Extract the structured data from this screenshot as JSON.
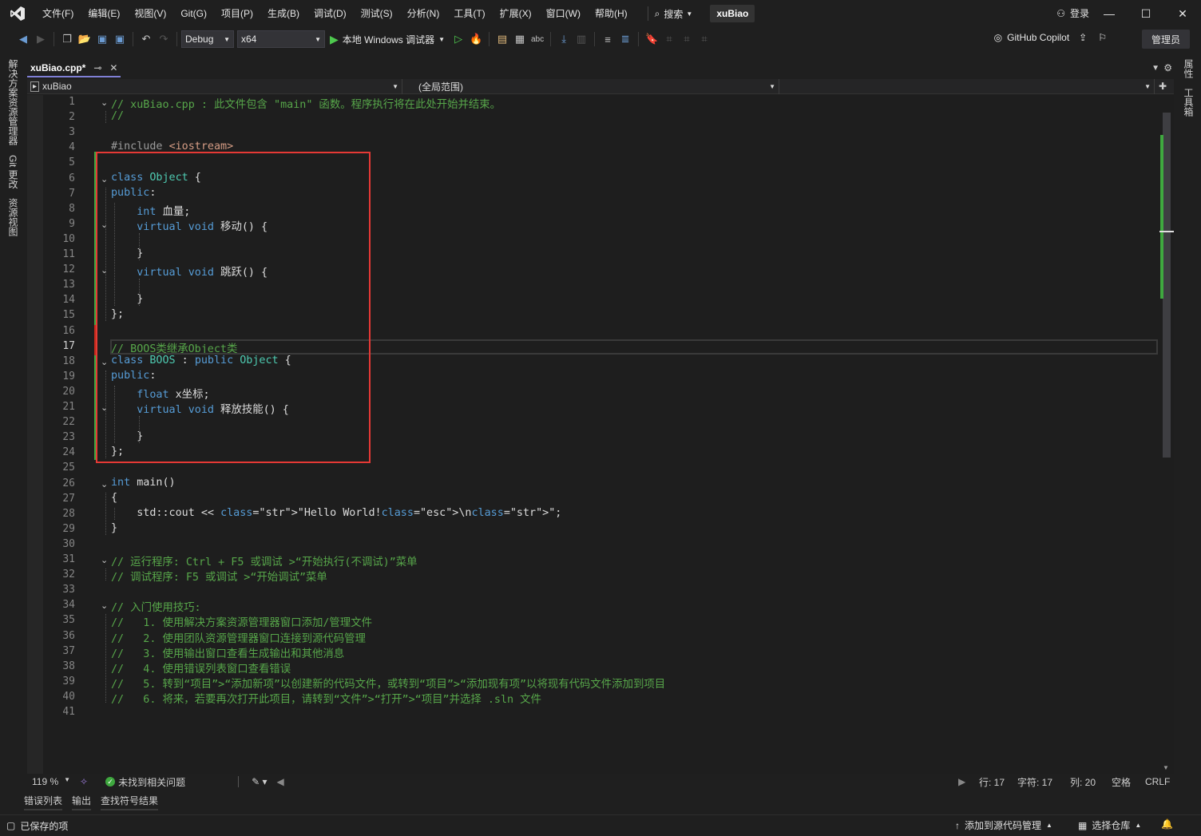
{
  "app": {
    "solution_name": "xuBiao"
  },
  "menu": [
    "文件(F)",
    "编辑(E)",
    "视图(V)",
    "Git(G)",
    "项目(P)",
    "生成(B)",
    "调试(D)",
    "测试(S)",
    "分析(N)",
    "工具(T)",
    "扩展(X)",
    "窗口(W)",
    "帮助(H)"
  ],
  "search_label": "搜索",
  "login_label": "登录",
  "toolbar": {
    "config": "Debug",
    "platform": "x64",
    "run_label": "本地 Windows 调试器",
    "copilot_label": "GitHub Copilot",
    "admin_label": "管理员"
  },
  "side_tabs": {
    "left": [
      "解决方案资源管理器",
      "Git 更改",
      "资源视图"
    ],
    "right": [
      "属性",
      "工具箱"
    ]
  },
  "editor_tab": {
    "title": "xuBiao.cpp*"
  },
  "navbar": {
    "project": "xuBiao",
    "scope": "(全局范围)",
    "member": ""
  },
  "code": {
    "current_line": 17,
    "lines": [
      "// xuBiao.cpp : 此文件包含 \"main\" 函数。程序执行将在此处开始并结束。",
      "//",
      "",
      "#include <iostream>",
      "",
      "class Object {",
      "public:",
      "    int 血量;",
      "    virtual void 移动() {",
      "",
      "    }",
      "    virtual void 跳跃() {",
      "",
      "    }",
      "};",
      "",
      "// BOOS类继承Object类",
      "class BOOS : public Object {",
      "public:",
      "    float x坐标;",
      "    virtual void 释放技能() {",
      "",
      "    }",
      "};",
      "",
      "int main()",
      "{",
      "    std::cout << \"Hello World!\\n\";",
      "}",
      "",
      "// 运行程序: Ctrl + F5 或调试 >“开始执行(不调试)”菜单",
      "// 调试程序: F5 或调试 >“开始调试”菜单",
      "",
      "// 入门使用技巧:",
      "//   1. 使用解决方案资源管理器窗口添加/管理文件",
      "//   2. 使用团队资源管理器窗口连接到源代码管理",
      "//   3. 使用输出窗口查看生成输出和其他消息",
      "//   4. 使用错误列表窗口查看错误",
      "//   5. 转到“项目”>“添加新项”以创建新的代码文件，或转到“项目”>“添加现有项”以将现有代码文件添加到项目",
      "//   6. 将来，若要再次打开此项目，请转到“文件”>“打开”>“项目”并选择 .sln 文件",
      ""
    ]
  },
  "editor_status": {
    "zoom": "119 %",
    "issues": "未找到相关问题",
    "line": "行: 17",
    "char": "字符: 17",
    "col": "列: 20",
    "whitespace": "空格",
    "eol": "CRLF"
  },
  "bottom_tabs": [
    "错误列表",
    "输出",
    "查找符号结果"
  ],
  "statusbar": {
    "saved": "已保存的项",
    "source_control": "添加到源代码管理",
    "repo": "选择仓库"
  },
  "colors": {
    "accent": "#7f7fd5",
    "keyword": "#569cd6",
    "type": "#4ec9b0",
    "comment": "#57a64a",
    "string": "#d69d85",
    "highlight_box": "#e53935",
    "change_green": "#3fa83f"
  }
}
